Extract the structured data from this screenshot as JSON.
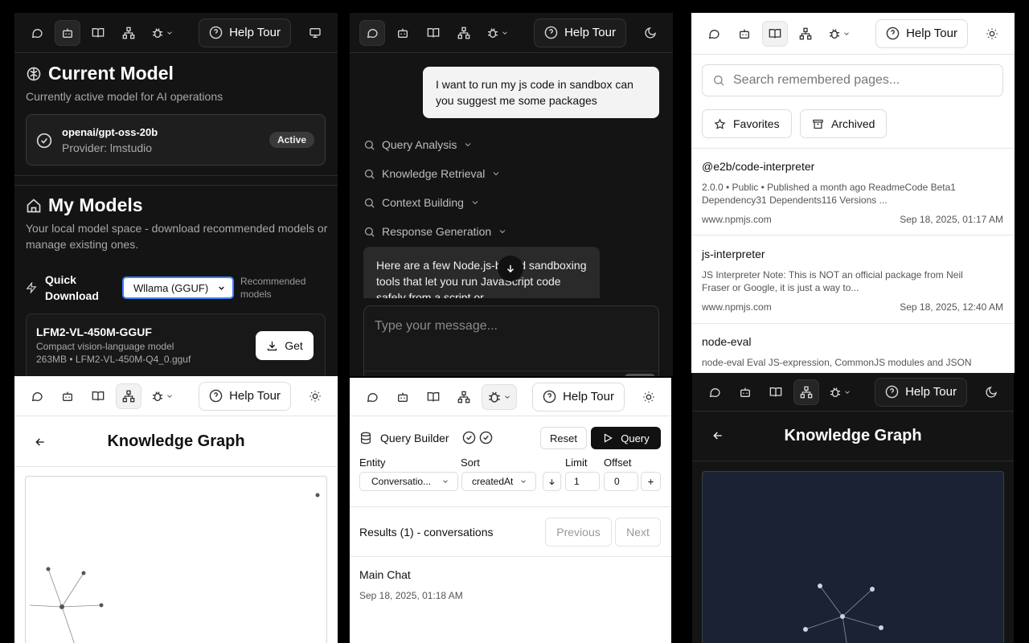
{
  "common": {
    "help_label": "Help Tour"
  },
  "p1": {
    "current_title": "Current Model",
    "current_sub": "Currently active model for AI operations",
    "model_name": "openai/gpt-oss-20b",
    "provider": "Provider: lmstudio",
    "active_badge": "Active",
    "my_title": "My Models",
    "my_sub": "Your local model space - download recommended models or manage existing ones.",
    "quick_label": "Quick Download",
    "select_value": "Wllama (GGUF)",
    "recommended": "Recommended models",
    "card_name": "LFM2-VL-450M-GGUF",
    "card_desc": "Compact vision-language model",
    "card_meta": "263MB • LFM2-VL-450M-Q4_0.gguf",
    "get_label": "Get"
  },
  "p2": {
    "user_msg": "I want to run my js code in sandbox can you suggest me some packages",
    "steps": [
      "Query Analysis",
      "Knowledge Retrieval",
      "Context Building",
      "Response Generation"
    ],
    "reply": "Here are a few Node.js-based sandboxing tools that let you run JavaScript code safely from a script or",
    "input_placeholder": "Type your message..."
  },
  "p3": {
    "search_placeholder": "Search remembered pages...",
    "favorites": "Favorites",
    "archived": "Archived",
    "items": [
      {
        "title": "@e2b/code-interpreter",
        "desc": "2.0.0 • Public • Published a month ago ReadmeCode Beta1 Dependency31 Dependents116 Versions ...",
        "domain": "www.npmjs.com",
        "date": "Sep 18, 2025, 01:17 AM"
      },
      {
        "title": "js-interpreter",
        "desc": "JS Interpreter Note: This is NOT an official package from Neil Fraser or Google, it is just a way to...",
        "domain": "www.npmjs.com",
        "date": "Sep 18, 2025, 12:40 AM"
      },
      {
        "title": "node-eval",
        "desc": "node-eval Eval JS-expression, CommonJS modules and JSON",
        "domain": "",
        "date": ""
      }
    ]
  },
  "p4": {
    "title": "Knowledge Graph"
  },
  "p5": {
    "title": "Query Builder",
    "reset": "Reset",
    "query": "Query",
    "entity_label": "Entity",
    "entity_value": "Conversatio...",
    "sort_label": "Sort",
    "sort_value": "createdAt",
    "limit_label": "Limit",
    "limit_value": "1",
    "offset_label": "Offset",
    "offset_value": "0",
    "results": "Results (1) - conversations",
    "prev": "Previous",
    "next": "Next",
    "row_title": "Main Chat",
    "row_date": "Sep 18, 2025, 01:18 AM"
  },
  "p6": {
    "title": "Knowledge Graph"
  }
}
